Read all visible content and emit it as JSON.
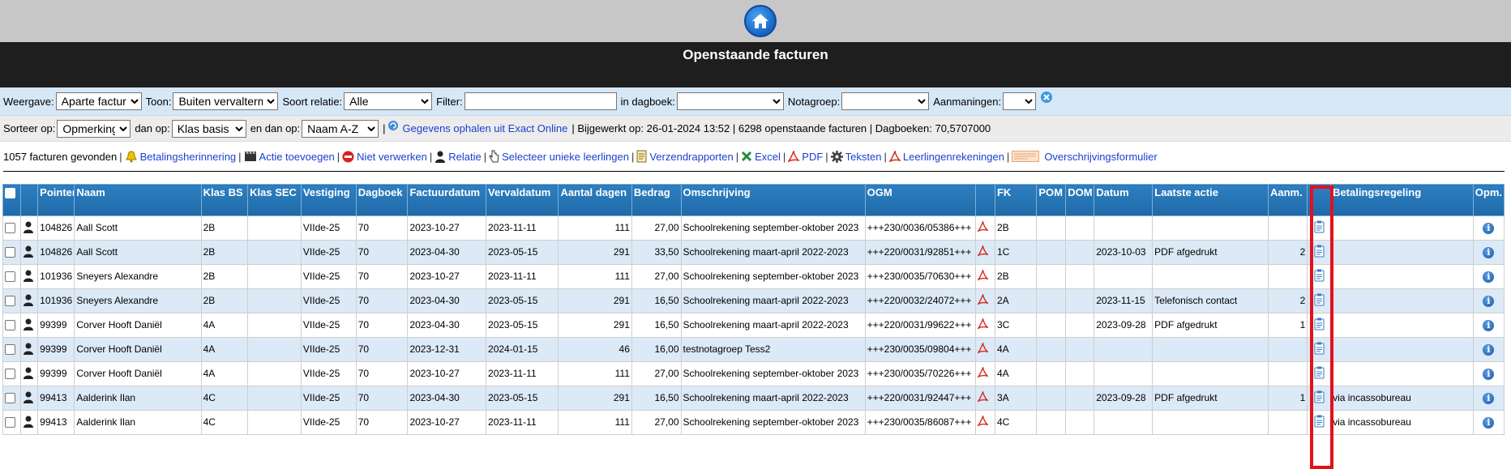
{
  "page": {
    "title": "Openstaande facturen"
  },
  "filters": {
    "weergave_label": "Weergave:",
    "weergave_value": "Aparte facturen",
    "toon_label": "Toon:",
    "toon_value": "Buiten vervaltermijn",
    "soort_label": "Soort relatie:",
    "soort_value": "Alle",
    "filter_label": "Filter:",
    "filter_value": "",
    "dagboek_label": "in dagboek:",
    "dagboek_value": "",
    "notagroep_label": "Notagroep:",
    "notagroep_value": "",
    "aanmaningen_label": "Aanmaningen:",
    "aanmaningen_value": ""
  },
  "sort": {
    "sorteer_label": "Sorteer op:",
    "sorteer_value": "Opmerkingen",
    "danop_label": "dan op:",
    "danop_value": "Klas basis A-Z",
    "endanop_label": "en dan op:",
    "endanop_value": "Naam A-Z",
    "exact_link": "Gegevens ophalen uit Exact Online",
    "status": "| Bijgewerkt op: 26-01-2024 13:52 | 6298 openstaande facturen | Dagboeken: 70,5707000"
  },
  "actions": {
    "count": "1057 facturen gevonden",
    "betalingsherinnering": "Betalingsherinnering",
    "actie_toevoegen": "Actie toevoegen",
    "niet_verwerken": "Niet verwerken",
    "relatie": "Relatie",
    "selecteer": "Selecteer unieke leerlingen",
    "verzendrapporten": "Verzendrapporten",
    "excel": "Excel",
    "pdf": "PDF",
    "teksten": "Teksten",
    "leerlingenrekeningen": "Leerlingenrekeningen",
    "overschrijvingsformulier": "Overschrijvingsformulier"
  },
  "table": {
    "headers": {
      "pointer": "Pointer",
      "naam": "Naam",
      "klas_bs": "Klas BS",
      "klas_sec": "Klas SEC",
      "vestiging": "Vestiging",
      "dagboek": "Dagboek",
      "factuurdatum": "Factuurdatum",
      "vervaldatum": "Vervaldatum",
      "aantal_dagen": "Aantal dagen",
      "bedrag": "Bedrag",
      "omschrijving": "Omschrijving",
      "ogm": "OGM",
      "fk": "FK",
      "pom": "POM",
      "dom": "DOM",
      "datum": "Datum",
      "laatste_actie": "Laatste actie",
      "aanm": "Aanm.",
      "betalingsregeling": "Betalingsregeling",
      "opm": "Opm."
    },
    "rows": [
      {
        "pointer": "104826",
        "naam": "Aall Scott",
        "klas_bs": "2B",
        "klas_sec": "",
        "vestiging": "VIIde-25",
        "dagboek": "70",
        "factuurdatum": "2023-10-27",
        "vervaldatum": "2023-11-11",
        "dagen": "111",
        "bedrag": "27,00",
        "omschrijving": "Schoolrekening september-oktober 2023",
        "ogm": "+++230/0036/05386+++",
        "fk": "2B",
        "pom": "",
        "dom": "",
        "datum": "",
        "laatste_actie": "",
        "aanm": "",
        "betalingsregeling": ""
      },
      {
        "pointer": "104826",
        "naam": "Aall Scott",
        "klas_bs": "2B",
        "klas_sec": "",
        "vestiging": "VIIde-25",
        "dagboek": "70",
        "factuurdatum": "2023-04-30",
        "vervaldatum": "2023-05-15",
        "dagen": "291",
        "bedrag": "33,50",
        "omschrijving": "Schoolrekening maart-april 2022-2023",
        "ogm": "+++220/0031/92851+++",
        "fk": "1C",
        "pom": "",
        "dom": "",
        "datum": "2023-10-03",
        "laatste_actie": "PDF afgedrukt",
        "aanm": "2",
        "betalingsregeling": ""
      },
      {
        "pointer": "101936",
        "naam": "Sneyers Alexandre",
        "klas_bs": "2B",
        "klas_sec": "",
        "vestiging": "VIIde-25",
        "dagboek": "70",
        "factuurdatum": "2023-10-27",
        "vervaldatum": "2023-11-11",
        "dagen": "111",
        "bedrag": "27,00",
        "omschrijving": "Schoolrekening september-oktober 2023",
        "ogm": "+++230/0035/70630+++",
        "fk": "2B",
        "pom": "",
        "dom": "",
        "datum": "",
        "laatste_actie": "",
        "aanm": "",
        "betalingsregeling": ""
      },
      {
        "pointer": "101936",
        "naam": "Sneyers Alexandre",
        "klas_bs": "2B",
        "klas_sec": "",
        "vestiging": "VIIde-25",
        "dagboek": "70",
        "factuurdatum": "2023-04-30",
        "vervaldatum": "2023-05-15",
        "dagen": "291",
        "bedrag": "16,50",
        "omschrijving": "Schoolrekening maart-april 2022-2023",
        "ogm": "+++220/0032/24072+++",
        "fk": "2A",
        "pom": "",
        "dom": "",
        "datum": "2023-11-15",
        "laatste_actie": "Telefonisch contact",
        "aanm": "2",
        "betalingsregeling": ""
      },
      {
        "pointer": "99399",
        "naam": "Corver Hooft Daniël",
        "klas_bs": "4A",
        "klas_sec": "",
        "vestiging": "VIIde-25",
        "dagboek": "70",
        "factuurdatum": "2023-04-30",
        "vervaldatum": "2023-05-15",
        "dagen": "291",
        "bedrag": "16,50",
        "omschrijving": "Schoolrekening maart-april 2022-2023",
        "ogm": "+++220/0031/99622+++",
        "fk": "3C",
        "pom": "",
        "dom": "",
        "datum": "2023-09-28",
        "laatste_actie": "PDF afgedrukt",
        "aanm": "1",
        "betalingsregeling": ""
      },
      {
        "pointer": "99399",
        "naam": "Corver Hooft Daniël",
        "klas_bs": "4A",
        "klas_sec": "",
        "vestiging": "VIIde-25",
        "dagboek": "70",
        "factuurdatum": "2023-12-31",
        "vervaldatum": "2024-01-15",
        "dagen": "46",
        "bedrag": "16,00",
        "omschrijving": "testnotagroep Tess2",
        "ogm": "+++230/0035/09804+++",
        "fk": "4A",
        "pom": "",
        "dom": "",
        "datum": "",
        "laatste_actie": "",
        "aanm": "",
        "betalingsregeling": ""
      },
      {
        "pointer": "99399",
        "naam": "Corver Hooft Daniël",
        "klas_bs": "4A",
        "klas_sec": "",
        "vestiging": "VIIde-25",
        "dagboek": "70",
        "factuurdatum": "2023-10-27",
        "vervaldatum": "2023-11-11",
        "dagen": "111",
        "bedrag": "27,00",
        "omschrijving": "Schoolrekening september-oktober 2023",
        "ogm": "+++230/0035/70226+++",
        "fk": "4A",
        "pom": "",
        "dom": "",
        "datum": "",
        "laatste_actie": "",
        "aanm": "",
        "betalingsregeling": ""
      },
      {
        "pointer": "99413",
        "naam": "Aalderink Ilan",
        "klas_bs": "4C",
        "klas_sec": "",
        "vestiging": "VIIde-25",
        "dagboek": "70",
        "factuurdatum": "2023-04-30",
        "vervaldatum": "2023-05-15",
        "dagen": "291",
        "bedrag": "16,50",
        "omschrijving": "Schoolrekening maart-april 2022-2023",
        "ogm": "+++220/0031/92447+++",
        "fk": "3A",
        "pom": "",
        "dom": "",
        "datum": "2023-09-28",
        "laatste_actie": "PDF afgedrukt",
        "aanm": "1",
        "betalingsregeling": "via incassobureau"
      },
      {
        "pointer": "99413",
        "naam": "Aalderink Ilan",
        "klas_bs": "4C",
        "klas_sec": "",
        "vestiging": "VIIde-25",
        "dagboek": "70",
        "factuurdatum": "2023-10-27",
        "vervaldatum": "2023-11-11",
        "dagen": "111",
        "bedrag": "27,00",
        "omschrijving": "Schoolrekening september-oktober 2023",
        "ogm": "+++230/0035/86087+++",
        "fk": "4C",
        "pom": "",
        "dom": "",
        "datum": "",
        "laatste_actie": "",
        "aanm": "",
        "betalingsregeling": "via incassobureau"
      }
    ]
  }
}
